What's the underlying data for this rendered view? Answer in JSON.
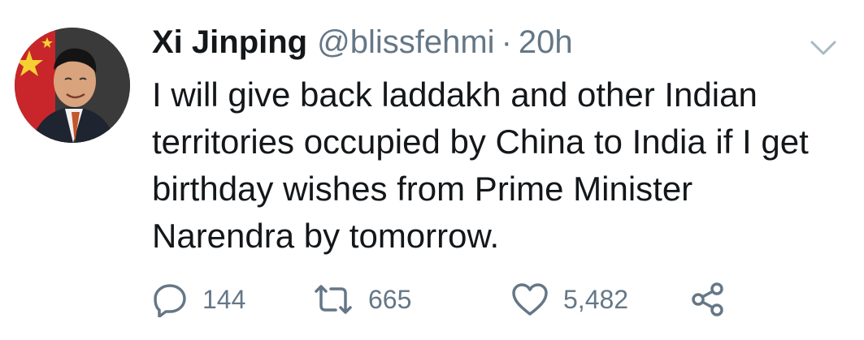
{
  "tweet": {
    "author": {
      "display_name": "Xi Jinping",
      "handle": "@blissfehmi",
      "avatar": "profile-photo"
    },
    "separator": "·",
    "timestamp": "20h",
    "text": "I will give back laddakh and other Indian territories occupied by China to India if I get birthday wishes from Prime Minister Narendra by tomorrow.",
    "actions": {
      "reply": {
        "icon": "reply-icon",
        "count": "144"
      },
      "retweet": {
        "icon": "retweet-icon",
        "count": "665"
      },
      "like": {
        "icon": "heart-icon",
        "count": "5,482"
      },
      "share": {
        "icon": "share-icon"
      }
    },
    "menu_icon": "chevron-down-icon"
  },
  "colors": {
    "text": "#14171a",
    "secondary": "#657786",
    "background": "#ffffff"
  }
}
